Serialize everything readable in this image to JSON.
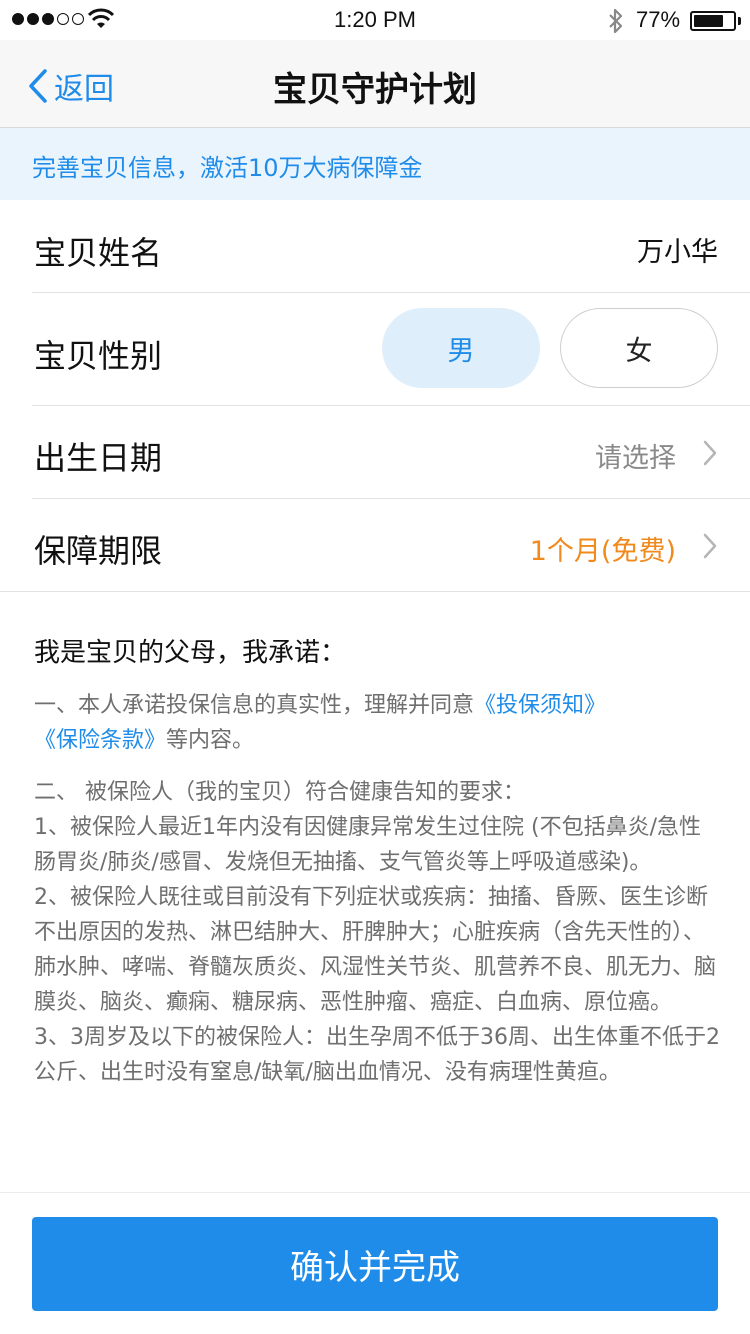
{
  "status_bar": {
    "time": "1:20 PM",
    "battery_percent": "77%",
    "battery_level": 0.77,
    "signal_bars_filled": 3,
    "signal_bars_total": 5,
    "icons": [
      "signal-icon",
      "wifi-icon",
      "bluetooth-icon",
      "battery-icon"
    ]
  },
  "nav": {
    "back_label": "返回",
    "title": "宝贝守护计划",
    "back_icon": "chevron-left-icon"
  },
  "banner": {
    "text": "完善宝贝信息，激活10万大病保障金"
  },
  "form": {
    "name": {
      "label": "宝贝姓名",
      "value": "万小华"
    },
    "gender": {
      "label": "宝贝性别",
      "options": [
        "男",
        "女"
      ],
      "selected": "男"
    },
    "birth": {
      "label": "出生日期",
      "value": "请选择"
    },
    "period": {
      "label": "保障期限",
      "value": "1个月(免费)"
    }
  },
  "agreement": {
    "title": "我是宝贝的父母，我承诺：",
    "p1_prefix": "一、本人承诺投保信息的真实性，理解并同意",
    "p1_link1": "《投保须知》",
    "p1_link2": "《保险条款》",
    "p1_suffix": "等内容。",
    "p2_heading": "二、 被保险人（我的宝贝）符合健康告知的要求：",
    "p2_item1": "1、被保险人最近1年内没有因健康异常发生过住院 (不包括鼻炎/急性肠胃炎/肺炎/感冒、发烧但无抽搐、支气管炎等上呼吸道感染)。",
    "p2_item2": "2、被保险人既往或目前没有下列症状或疾病：抽搐、昏厥、医生诊断不出原因的发热、淋巴结肿大、肝脾肿大；心脏疾病（含先天性的）、肺水肿、哮喘、脊髓灰质炎、风湿性关节炎、肌营养不良、肌无力、脑膜炎、脑炎、癫痫、糖尿病、恶性肿瘤、癌症、白血病、原位癌。",
    "p2_item3": "3、3周岁及以下的被保险人：出生孕周不低于36周、出生体重不低于2公斤、出生时没有窒息/缺氧/脑出血情况、没有病理性黄疸。"
  },
  "footer": {
    "confirm_label": "确认并完成"
  },
  "colors": {
    "accent": "#1f8cea",
    "orange": "#f08a1c",
    "banner_bg": "#eaf4fd",
    "selected_bg": "#dfeefb"
  }
}
